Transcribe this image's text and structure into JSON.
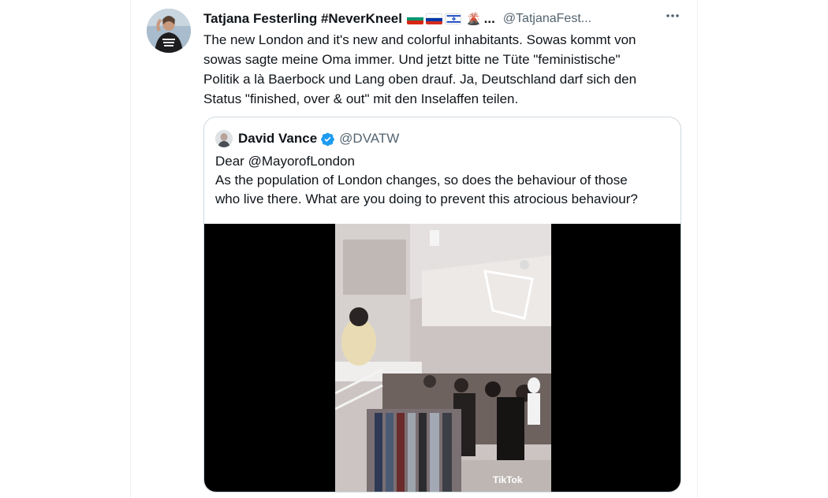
{
  "tweet": {
    "author_name": "Tatjana Festerling #NeverKneel",
    "author_handle": "@TatjanaFest...",
    "flags": [
      {
        "name": "bulgaria-flag",
        "colors": [
          "#ffffff",
          "#00966e",
          "#d62612"
        ]
      },
      {
        "name": "russia-flag",
        "colors": [
          "#ffffff",
          "#0039a6",
          "#d52b1e"
        ]
      },
      {
        "name": "israel-flag",
        "colors": [
          "#ffffff",
          "#0038b8",
          "#ffffff"
        ]
      }
    ],
    "emoji": "🌋",
    "name_ellipsis": "...",
    "more_icon": "more-horizontal-icon",
    "text_lines": [
      "The new London and it's new and colorful inhabitants. Sowas kommt von",
      "sowas sagte meine Oma immer. Und jetzt bitte ne Tüte \"feministische\"",
      "Politik a là Baerbock und Lang oben drauf. Ja, Deutschland darf sich den",
      "Status \"finished, over & out\" mit den Inselaffen teilen."
    ]
  },
  "quote": {
    "author_name": "David Vance",
    "author_handle": "@DVATW",
    "verified": true,
    "text_lines": [
      "Dear @MayorofLondon",
      "As the population of London changes, so does the behaviour of those",
      "who live there. What are you doing to prevent this atrocious behaviour?"
    ],
    "video_watermark": "TikTok"
  },
  "colors": {
    "text": "#0f1419",
    "secondary": "#536471",
    "border": "#cfd9de",
    "verified": "#1d9bf0"
  }
}
